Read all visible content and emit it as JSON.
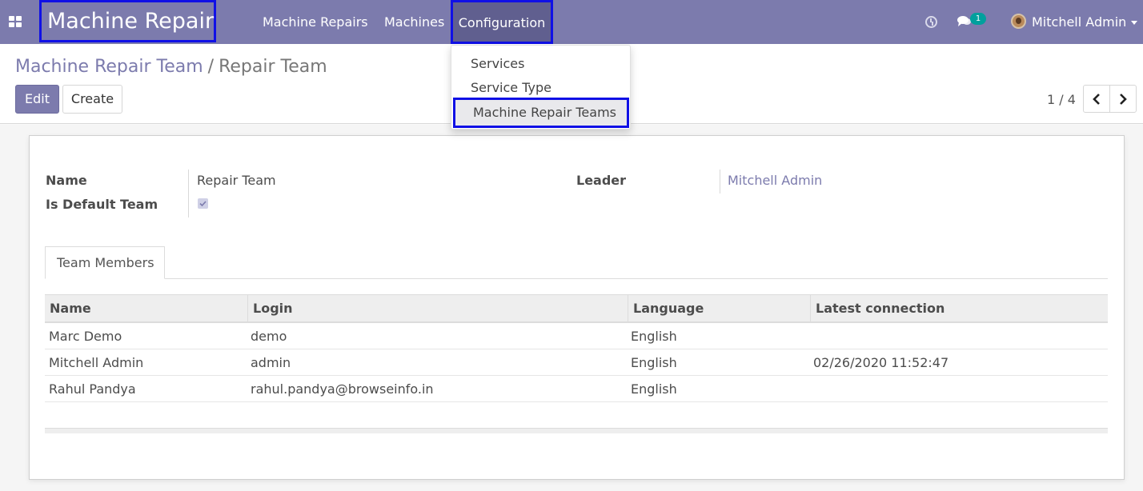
{
  "navbar": {
    "app_title": "Machine Repair",
    "menu": [
      "Machine Repairs",
      "Machines",
      "Configuration"
    ],
    "message_count": "1",
    "user_name": "Mitchell Admin",
    "accent_color": "#7c7bad"
  },
  "config_dropdown": {
    "items": [
      "Services",
      "Service Type",
      "Machine Repair Teams"
    ]
  },
  "breadcrumb": {
    "parent": "Machine Repair Team",
    "separator": "/",
    "current": "Repair Team"
  },
  "buttons": {
    "edit": "Edit",
    "create": "Create"
  },
  "pager": {
    "value": "1 / 4"
  },
  "form": {
    "name_label": "Name",
    "name_value": "Repair Team",
    "default_label": "Is Default Team",
    "default_checked": true,
    "leader_label": "Leader",
    "leader_value": "Mitchell Admin"
  },
  "tabs": [
    "Team Members"
  ],
  "members_table": {
    "columns": [
      "Name",
      "Login",
      "Language",
      "Latest connection"
    ],
    "rows": [
      [
        "Marc Demo",
        "demo",
        "English",
        ""
      ],
      [
        "Mitchell Admin",
        "admin",
        "English",
        "02/26/2020 11:52:47"
      ],
      [
        "Rahul Pandya",
        "rahul.pandya@browseinfo.in",
        "English",
        ""
      ]
    ]
  }
}
